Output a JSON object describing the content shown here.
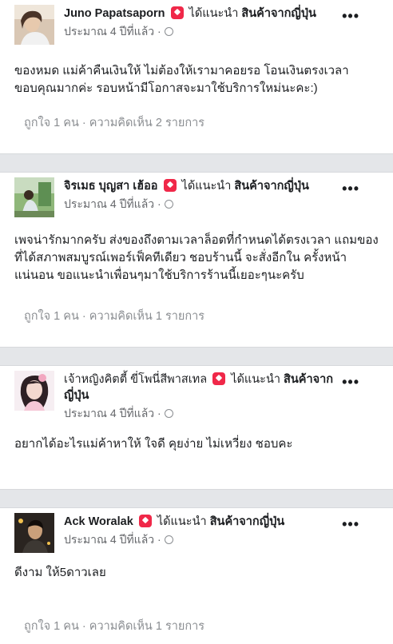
{
  "reviews": [
    {
      "author": "Juno Papatsaporn",
      "recommends": "ได้แนะนำ",
      "page": "สินค้าจากญี่ปุ่น",
      "time": "ประมาณ 4 ปีที่แล้ว ·",
      "text": "ของหมด แม่ค้าคืนเงินให้ ไม่ต้องให้เรามาคอยรอ โอนเงินตรงเวลา ขอบคุณมากค่ะ รอบหน้ามีโอกาสจะมาใช้บริการใหม่นะคะ:)",
      "footer": "ถูกใจ 1 คน · ความคิดเห็น 2 รายการ",
      "more": "•••"
    },
    {
      "author": "จิรเมธ บุญสา เฮ้ออ",
      "recommends": "ได้แนะนำ",
      "page": "สินค้าจากญี่ปุ่น",
      "time": "ประมาณ 4 ปีที่แล้ว ·",
      "text": "เพจน่ารักมากครับ ส่งของถึงตามเวลาล็อตที่กำหนดได้ตรงเวลา แถมของที่ได้สภาพสมบูรณ์เพอร์เฟ็คทีเดียว ชอบร้านนี้ จะสั่งอีกใน ครั้งหน้าแน่นอน ขอแนะนำเพื่อนๆมาใช้บริการร้านนี้เยอะๆนะครับ",
      "footer": "ถูกใจ 1 คน · ความคิดเห็น 1 รายการ",
      "more": "•••"
    },
    {
      "author": "เจ้าหญิงคิตตี้ ขี่โพนี่สีพาสเทล",
      "recommends": "ได้แนะนำ",
      "page": "สินค้าจากญี่ปุ่น",
      "time": "ประมาณ 4 ปีที่แล้ว ·",
      "text": "อยากได้อะไรแม่ค้าหาให้ ใจดี คุยง่าย ไม่เหวี่ยง ชอบคะ",
      "footer": "",
      "more": "•••"
    },
    {
      "author": "Ack Woralak",
      "recommends": "ได้แนะนำ",
      "page": "สินค้าจากญี่ปุ่น",
      "time": "ประมาณ 4 ปีที่แล้ว ·",
      "text": "ดีงาม ให้5ดาวเลย",
      "footer": "ถูกใจ 1 คน · ความคิดเห็น 1 รายการ",
      "more": "•••"
    }
  ],
  "colors": {
    "badge": "#f02849",
    "separator": "#e4e6e9",
    "muted": "#65676b"
  }
}
